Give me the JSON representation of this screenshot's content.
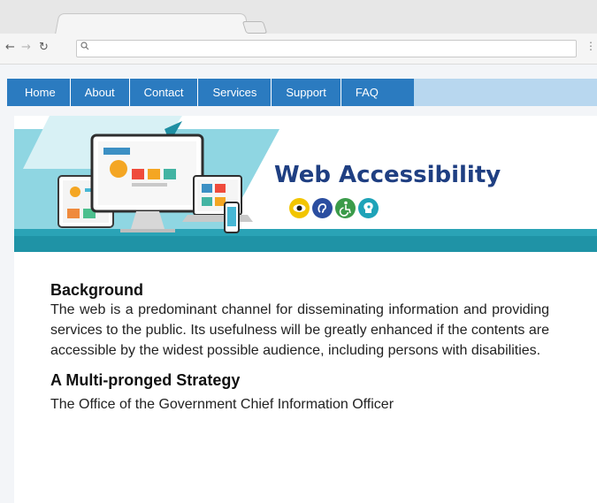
{
  "browser": {
    "url": "",
    "back_icon": "arrow-left-icon",
    "forward_icon": "arrow-right-icon",
    "reload_icon": "reload-icon",
    "search_icon": "search-icon",
    "menu_icon": "more-vertical-icon"
  },
  "nav": {
    "items": [
      {
        "label": "Home"
      },
      {
        "label": "About"
      },
      {
        "label": "Contact"
      },
      {
        "label": "Services"
      },
      {
        "label": "Support"
      },
      {
        "label": "FAQ"
      }
    ]
  },
  "banner": {
    "title": "Web Accessibility",
    "icons": [
      "eye-icon",
      "hearing-icon",
      "wheelchair-icon",
      "cognitive-icon"
    ]
  },
  "article": {
    "heading1": "Background",
    "paragraph1": "The web is a predominant channel for disseminating information and providing services to the public. Its usefulness will be greatly enhanced if the contents are accessible by the widest possible audience, including persons with disabilities.",
    "heading2": "A Multi-pronged Strategy",
    "paragraph2": "The Office of the Government Chief Information Officer"
  },
  "colors": {
    "nav_bg": "#2b7bc0",
    "nav_bar_ext": "#b8d7ef",
    "title": "#1f3f82",
    "banner_teal": "#1f93a6",
    "banner_light": "#7fd0df"
  }
}
